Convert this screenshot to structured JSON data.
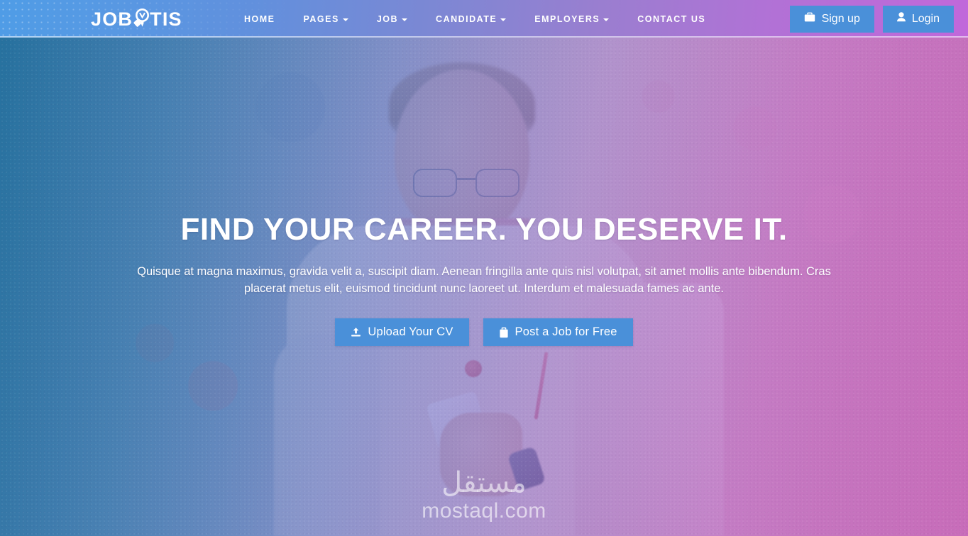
{
  "site": {
    "brand": {
      "part1": "JOB",
      "part2": "TIS",
      "mark_icon": "magnifier-bulb-icon"
    },
    "theme": {
      "header_gradient_start": "#4f9ce6",
      "header_gradient_end": "#c168da",
      "button_blue": "#4a90d9",
      "hero_overlay_start": "#186ea0",
      "hero_overlay_end": "#c860c4",
      "text_white": "#ffffff"
    }
  },
  "nav": {
    "items": [
      {
        "label": "HOME",
        "has_dropdown": false
      },
      {
        "label": "PAGES",
        "has_dropdown": true
      },
      {
        "label": "JOB",
        "has_dropdown": true
      },
      {
        "label": "CANDIDATE",
        "has_dropdown": true
      },
      {
        "label": "EMPLOYERS",
        "has_dropdown": true
      },
      {
        "label": "CONTACT US",
        "has_dropdown": false
      }
    ]
  },
  "header_actions": {
    "signup": {
      "label": "Sign up",
      "icon": "briefcase-icon"
    },
    "login": {
      "label": "Login",
      "icon": "user-icon"
    }
  },
  "hero": {
    "title": "FIND YOUR CAREER. YOU DESERVE IT.",
    "subtitle": "Quisque at magna maximus, gravida velit a, suscipit diam. Aenean fringilla ante quis nisl volutpat, sit amet mollis ante bibendum. Cras placerat metus elit, euismod tincidunt nunc laoreet ut. Interdum et malesuada fames ac ante.",
    "buttons": [
      {
        "label": "Upload Your CV",
        "icon": "upload-icon"
      },
      {
        "label": "Post a Job for Free",
        "icon": "briefcase-icon"
      }
    ]
  },
  "watermark": {
    "arabic": "مستقل",
    "domain": "mostaql.com"
  }
}
